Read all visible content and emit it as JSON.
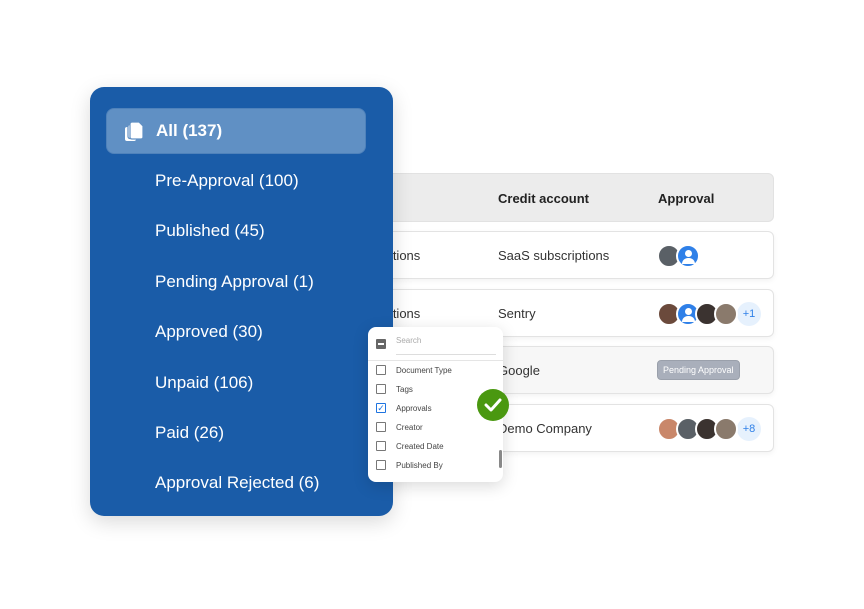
{
  "sidebar": {
    "items": [
      {
        "label": "All (137)",
        "icon": "documents-icon",
        "active": true
      },
      {
        "label": "Pre-Approval (100)"
      },
      {
        "label": "Published (45)"
      },
      {
        "label": "Pending Approval (1)"
      },
      {
        "label": "Approved (30)"
      },
      {
        "label": "Unpaid (106)"
      },
      {
        "label": "Paid (26)"
      },
      {
        "label": "Approval Rejected (6)"
      }
    ],
    "color": "#1a5ca8"
  },
  "table": {
    "headers": [
      "",
      "Credit account",
      "Approval"
    ],
    "rows": [
      {
        "account": "SaaS subscriptions",
        "credit": "SaaS subscriptions",
        "approvers": [
          "photo",
          "user"
        ]
      },
      {
        "account": "SaaS subscriptions",
        "credit": "Sentry",
        "approvers": [
          "photo",
          "user",
          "photo",
          "photo"
        ],
        "more": "+1"
      },
      {
        "account": "",
        "credit": "Google",
        "badge": "Pending Approval"
      },
      {
        "account": "",
        "credit": "Demo Company",
        "approvers": [
          "photo",
          "photo",
          "photo",
          "photo"
        ],
        "more": "+8"
      }
    ]
  },
  "dropdown": {
    "search_placeholder": "Search",
    "options": [
      {
        "label": "Document Type",
        "checked": false
      },
      {
        "label": "Tags",
        "checked": false
      },
      {
        "label": "Approvals",
        "checked": true
      },
      {
        "label": "Creator",
        "checked": false
      },
      {
        "label": "Created Date",
        "checked": false
      },
      {
        "label": "Published By",
        "checked": false
      }
    ]
  },
  "success_color": "#4a9810"
}
